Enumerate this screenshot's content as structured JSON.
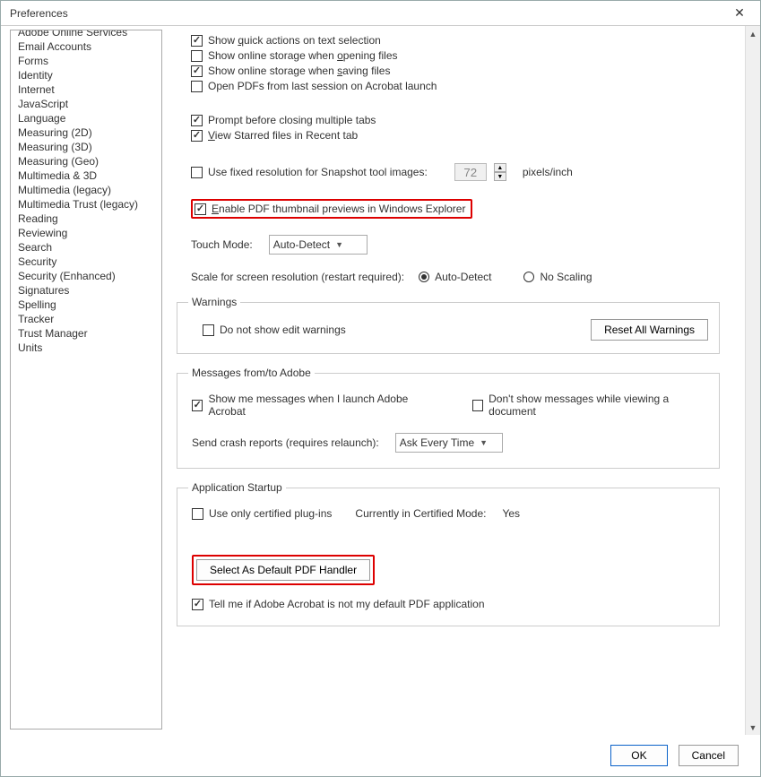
{
  "window": {
    "title": "Preferences"
  },
  "sidebar": {
    "items": [
      "Adobe Online Services",
      "Email Accounts",
      "Forms",
      "Identity",
      "Internet",
      "JavaScript",
      "Language",
      "Measuring (2D)",
      "Measuring (3D)",
      "Measuring (Geo)",
      "Multimedia & 3D",
      "Multimedia (legacy)",
      "Multimedia Trust (legacy)",
      "Reading",
      "Reviewing",
      "Search",
      "Security",
      "Security (Enhanced)",
      "Signatures",
      "Spelling",
      "Tracker",
      "Trust Manager",
      "Units"
    ]
  },
  "basic": {
    "quick_actions": {
      "label_pre": "Show ",
      "u": "q",
      "label_post": "uick actions on text selection",
      "checked": true
    },
    "storage_open": {
      "label_pre": "Show online storage when ",
      "u": "o",
      "label_post": "pening files",
      "checked": false
    },
    "storage_save": {
      "label_pre": "Show online storage when ",
      "u": "s",
      "label_post": "aving files",
      "checked": true
    },
    "open_last": {
      "label_pre": "Open PDFs from last session on Acrobat launch",
      "u": "",
      "label_post": "",
      "checked": false
    },
    "prompt_close": {
      "label_pre": "Prompt before closing multiple tabs",
      "u": "",
      "label_post": "",
      "checked": true
    },
    "view_starred": {
      "label_pre": "",
      "u": "V",
      "label_post": "iew Starred files in Recent tab",
      "checked": true
    },
    "snapshot": {
      "label": "Use fixed resolution for Snapshot tool images:",
      "checked": false,
      "value": "72",
      "unit": "pixels/inch"
    },
    "thumb_preview": {
      "label_pre": "",
      "u": "E",
      "label_post": "nable PDF thumbnail previews in Windows Explorer",
      "checked": true
    },
    "touch_mode": {
      "label": "Touch Mode:",
      "value": "Auto-Detect"
    },
    "scale_label": "Scale for screen resolution (restart required):",
    "scale_auto": "Auto-Detect",
    "scale_none": "No Scaling",
    "scale_selected": "auto"
  },
  "warnings": {
    "legend": "Warnings",
    "do_not_show": {
      "label": "Do not show edit warnings",
      "checked": false
    },
    "reset_btn": "Reset All Warnings"
  },
  "messages": {
    "legend": "Messages from/to Adobe",
    "show_launch": {
      "label": "Show me messages when I launch Adobe Acrobat",
      "checked": true
    },
    "dont_show_view": {
      "label": "Don't show messages while viewing a document",
      "checked": false
    },
    "crash_label": "Send crash reports (requires relaunch):",
    "crash_value": "Ask Every Time"
  },
  "startup": {
    "legend": "Application Startup",
    "certified": {
      "label": "Use only certified plug-ins",
      "checked": false
    },
    "cert_mode_label": "Currently in Certified Mode:",
    "cert_mode_value": "Yes",
    "default_handler_btn": "Select As Default PDF Handler",
    "tell_default": {
      "label": "Tell me if Adobe Acrobat is not my default PDF application",
      "checked": true
    }
  },
  "footer": {
    "ok": "OK",
    "cancel": "Cancel"
  }
}
